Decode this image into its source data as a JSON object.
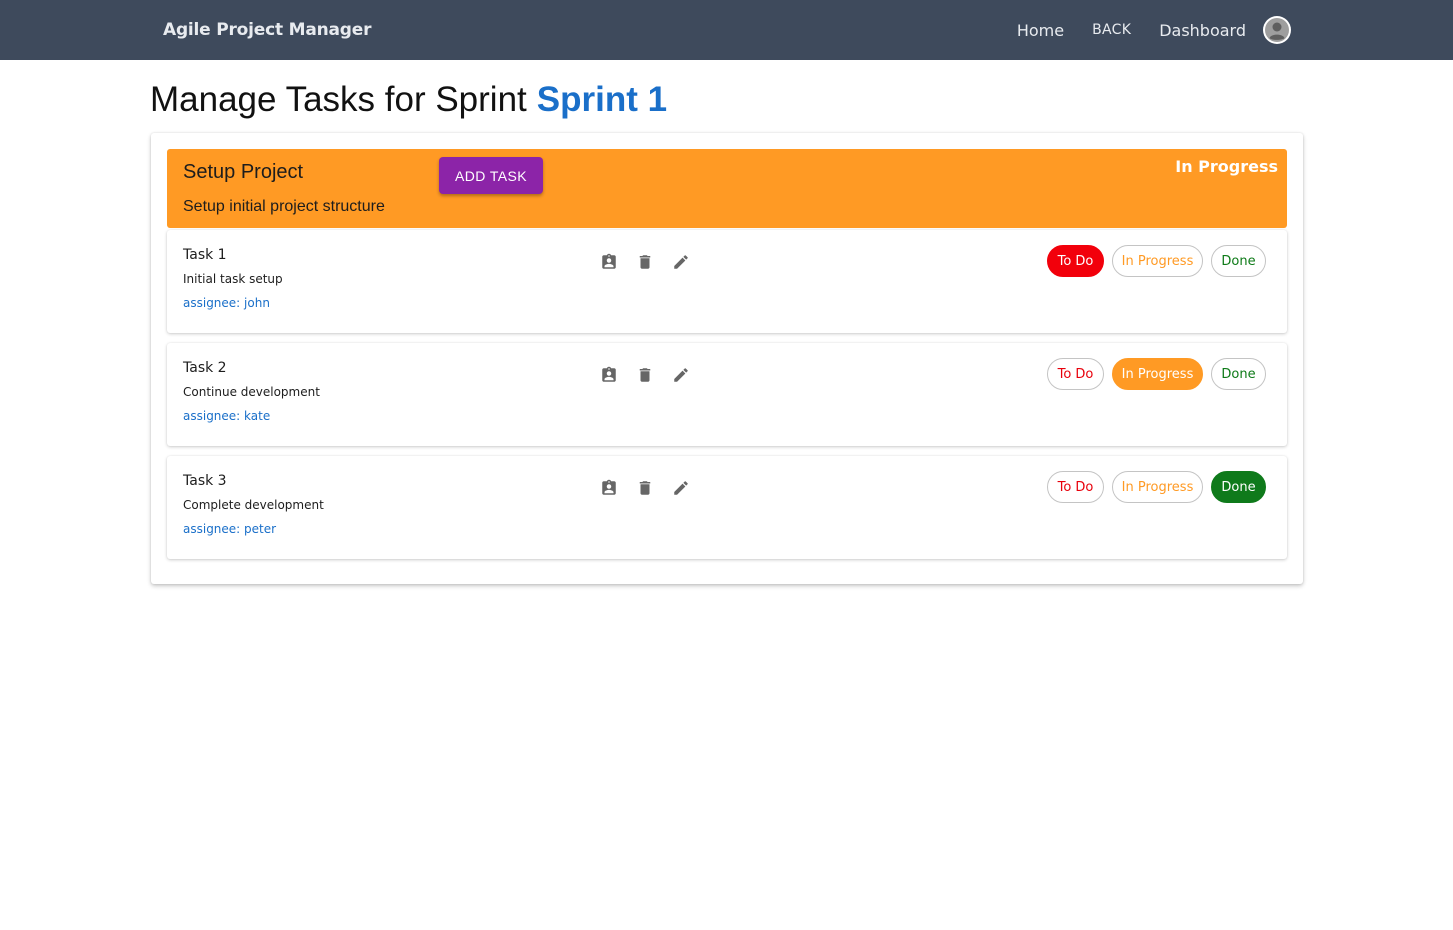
{
  "navbar": {
    "brand": "Agile Project Manager",
    "links": {
      "home": "Home",
      "back": "BACK",
      "dashboard": "Dashboard"
    },
    "avatar_icon": "account-circle-icon"
  },
  "page": {
    "title_prefix": "Manage Tasks for Sprint",
    "sprint_name": "Sprint 1"
  },
  "story": {
    "title": "Setup Project",
    "description": "Setup initial project structure",
    "add_task_label": "ADD TASK",
    "status": "In Progress",
    "color": "#ff9a24"
  },
  "status_labels": {
    "todo": "To Do",
    "in_progress": "In Progress",
    "done": "Done"
  },
  "status_colors": {
    "todo": "#f2000b",
    "in_progress": "#ff9a24",
    "done": "#0f7a1b"
  },
  "tasks": [
    {
      "title": "Task 1",
      "description": "Initial task setup",
      "assignee": "assignee: john",
      "status": "todo"
    },
    {
      "title": "Task 2",
      "description": "Continue development",
      "assignee": "assignee: kate",
      "status": "in_progress"
    },
    {
      "title": "Task 3",
      "description": "Complete development",
      "assignee": "assignee: peter",
      "status": "done"
    }
  ],
  "task_action_icons": [
    "assign-user-icon",
    "delete-icon",
    "edit-icon"
  ]
}
